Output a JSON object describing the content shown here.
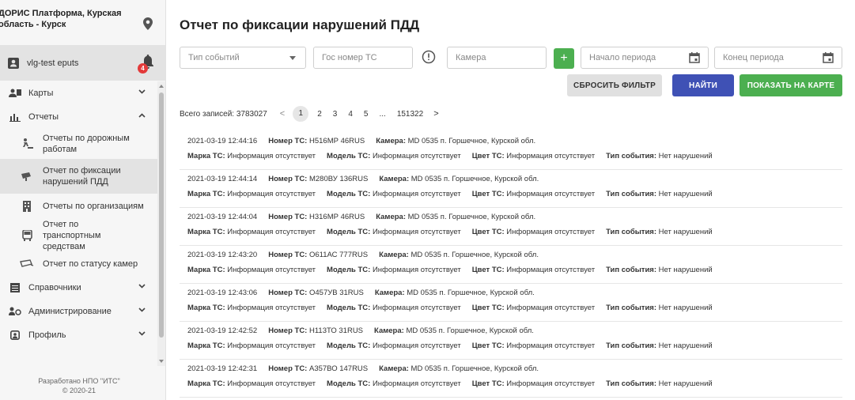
{
  "sidebar": {
    "brand": "ДОРИС Платформа, Курская область - Курск",
    "user": "vlg-test eputs",
    "notifications_count": "4",
    "menu": {
      "maps": "Карты",
      "reports": "Отчеты",
      "sub": [
        "Отчеты по дорожным работам",
        "Отчет по фиксации нарушений ПДД",
        "Отчеты по организациям",
        "Отчет по транспортным средствам",
        "Отчет по статусу камер"
      ],
      "directories": "Справочники",
      "administration": "Администрирование",
      "profile": "Профиль"
    },
    "footer_line1": "Разработано НПО \"ИТС\"",
    "footer_line2": "© 2020-21"
  },
  "main": {
    "title": "Отчет по фиксации нарушений ПДД",
    "filters": {
      "event_type_placeholder": "Тип событий",
      "plate_placeholder": "Гос номер ТС",
      "camera_placeholder": "Камера",
      "period_start_placeholder": "Начало периода",
      "period_end_placeholder": "Конец периода"
    },
    "buttons": {
      "reset": "СБРОСИТЬ ФИЛЬТР",
      "find": "НАЙТИ",
      "show_on_map": "ПОКАЗАТЬ НА КАРТЕ",
      "add": "+"
    },
    "pager": {
      "total": "Всего записей: 3783027",
      "pages": [
        "1",
        "2",
        "3",
        "4",
        "5",
        "...",
        "151322"
      ],
      "prev": "<",
      "next": ">"
    },
    "labels": {
      "plate": "Номер ТС:",
      "camera": "Камера:",
      "brand": "Марка ТС:",
      "model": "Модель ТС:",
      "color": "Цвет ТС:",
      "event_type": "Тип события:"
    },
    "records": [
      {
        "datetime": "2021-03-19 12:44:16",
        "plate": "Н516МР 46RUS",
        "camera": "MD 0535 п. Горшечное, Курской обл.",
        "brand": "Информация отсутствует",
        "model": "Информация отсутствует",
        "color": "Информация отсутствует",
        "event": "Нет нарушений"
      },
      {
        "datetime": "2021-03-19 12:44:14",
        "plate": "М280ВУ 136RUS",
        "camera": "MD 0535 п. Горшечное, Курской обл.",
        "brand": "Информация отсутствует",
        "model": "Информация отсутствует",
        "color": "Информация отсутствует",
        "event": "Нет нарушений"
      },
      {
        "datetime": "2021-03-19 12:44:04",
        "plate": "Н316МР 46RUS",
        "camera": "MD 0535 п. Горшечное, Курской обл.",
        "brand": "Информация отсутствует",
        "model": "Информация отсутствует",
        "color": "Информация отсутствует",
        "event": "Нет нарушений"
      },
      {
        "datetime": "2021-03-19 12:43:20",
        "plate": "О611АС 777RUS",
        "camera": "MD 0535 п. Горшечное, Курской обл.",
        "brand": "Информация отсутствует",
        "model": "Информация отсутствует",
        "color": "Информация отсутствует",
        "event": "Нет нарушений"
      },
      {
        "datetime": "2021-03-19 12:43:06",
        "plate": "О457УВ 31RUS",
        "camera": "MD 0535 п. Горшечное, Курской обл.",
        "brand": "Информация отсутствует",
        "model": "Информация отсутствует",
        "color": "Информация отсутствует",
        "event": "Нет нарушений"
      },
      {
        "datetime": "2021-03-19 12:42:52",
        "plate": "Н113ТО 31RUS",
        "camera": "MD 0535 п. Горшечное, Курской обл.",
        "brand": "Информация отсутствует",
        "model": "Информация отсутствует",
        "color": "Информация отсутствует",
        "event": "Нет нарушений"
      },
      {
        "datetime": "2021-03-19 12:42:31",
        "plate": "А357ВО 147RUS",
        "camera": "MD 0535 п. Горшечное, Курской обл.",
        "brand": "Информация отсутствует",
        "model": "Информация отсутствует",
        "color": "Информация отсутствует",
        "event": "Нет нарушений"
      }
    ]
  },
  "colors": {
    "accent_green": "#4caf50",
    "accent_blue": "#3f51b5",
    "badge_red": "#e33a3a"
  }
}
